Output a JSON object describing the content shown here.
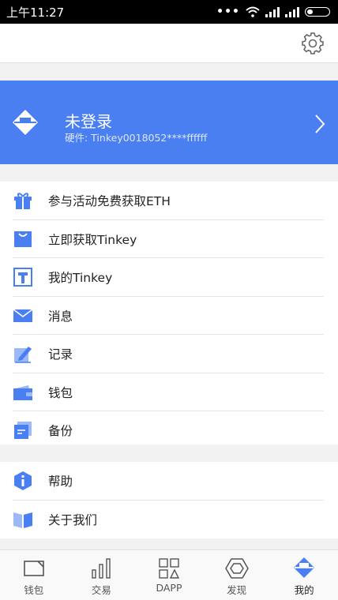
{
  "status_bar": {
    "time": "上午11:27",
    "dots": "•••"
  },
  "header": {
    "settings_icon": "gear-icon"
  },
  "account": {
    "title": "未登录",
    "hardware": "硬件: Tinkey0018052****ffffff",
    "logo_icon": "tinkey-logo-icon",
    "chevron_icon": "chevron-right-icon"
  },
  "menu": {
    "group1": [
      {
        "label": "参与活动免费获取ETH",
        "icon": "gift-icon"
      },
      {
        "label": "立即获取Tinkey",
        "icon": "shopping-bag-icon"
      },
      {
        "label": "我的Tinkey",
        "icon": "tinkey-device-icon"
      },
      {
        "label": "消息",
        "icon": "mail-icon"
      },
      {
        "label": "记录",
        "icon": "pen-record-icon"
      },
      {
        "label": "钱包",
        "icon": "wallet-icon"
      },
      {
        "label": "备份",
        "icon": "backup-icon"
      }
    ],
    "group2": [
      {
        "label": "帮助",
        "icon": "help-icon"
      },
      {
        "label": "关于我们",
        "icon": "book-icon"
      }
    ]
  },
  "tabs": [
    {
      "label": "钱包",
      "icon": "wallet-tab-icon",
      "active": false
    },
    {
      "label": "交易",
      "icon": "bar-chart-icon",
      "active": false
    },
    {
      "label": "DAPP",
      "icon": "dapp-grid-icon",
      "active": false
    },
    {
      "label": "发现",
      "icon": "hexagon-icon",
      "active": false
    },
    {
      "label": "我的",
      "icon": "profile-logo-icon",
      "active": true
    }
  ],
  "colors": {
    "accent": "#4a7ff2",
    "accent_light": "#9bb8f7"
  }
}
